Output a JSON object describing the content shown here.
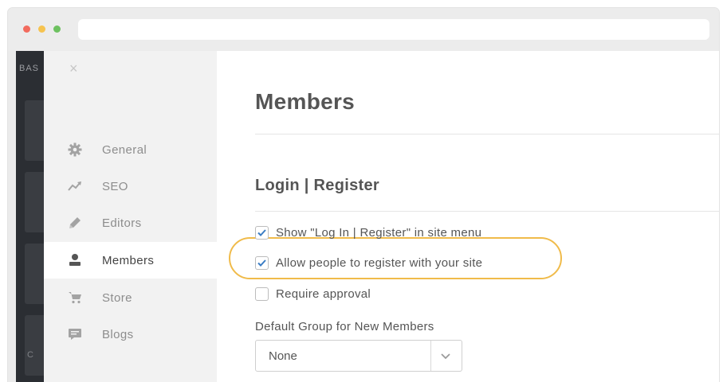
{
  "darkbar": {
    "top_text": "BAS",
    "bottom_text": "C"
  },
  "sidebar": {
    "close_glyph": "×",
    "items": [
      {
        "label": "General",
        "icon": "gear-icon"
      },
      {
        "label": "SEO",
        "icon": "trend-icon"
      },
      {
        "label": "Editors",
        "icon": "pencil-icon"
      },
      {
        "label": "Members",
        "icon": "person-icon",
        "active": true
      },
      {
        "label": "Store",
        "icon": "cart-icon"
      },
      {
        "label": "Blogs",
        "icon": "blog-icon"
      }
    ]
  },
  "main": {
    "title": "Members",
    "section_title": "Login | Register",
    "options": [
      {
        "label": "Show \"Log In | Register\" in site menu",
        "checked": true
      },
      {
        "label": "Allow people to register with your site",
        "checked": true
      },
      {
        "label": "Require approval",
        "checked": false
      }
    ],
    "default_group_label": "Default Group for New Members",
    "default_group_value": "None"
  },
  "colors": {
    "highlight": "#f0bb4a",
    "checkmark": "#3b7dc4",
    "sidebar_bg": "#f2f2f2",
    "dark_bar": "#2b2e33"
  }
}
